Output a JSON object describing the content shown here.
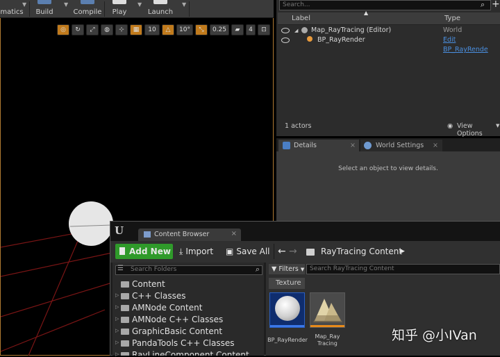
{
  "toolbar": {
    "items": [
      {
        "label": "matics"
      },
      {
        "label": "Build"
      },
      {
        "label": "Compile"
      },
      {
        "label": "Play"
      },
      {
        "label": "Launch"
      }
    ]
  },
  "viewport": {
    "tools": [
      "10",
      "10°",
      "0.25",
      "4"
    ]
  },
  "outliner": {
    "search_placeholder": "Search...",
    "columns": {
      "label": "Label",
      "type": "Type"
    },
    "rows": [
      {
        "label": "Map_RayTracing (Editor)",
        "type": "World"
      },
      {
        "label": "BP_RayRender",
        "type": "Edit BP_RayRende"
      }
    ],
    "actor_count": "1 actors",
    "view_options": "View Options"
  },
  "details": {
    "tabs": [
      "Details",
      "World Settings"
    ],
    "empty_message": "Select an object to view details."
  },
  "content_browser": {
    "tab": "Content Browser",
    "add_new": "Add New",
    "import": "Import",
    "save_all": "Save All",
    "path": "RayTracing Content",
    "search_folders": "Search Folders",
    "filters": "Filters",
    "search_assets": "Search RayTracing Content",
    "filter_chip": "Texture",
    "folders": [
      "Content",
      "C++ Classes",
      "AMNode Content",
      "AMNode C++ Classes",
      "GraphicBasic Content",
      "PandaTools C++ Classes",
      "RayLineComponent Content"
    ],
    "assets": [
      {
        "name": "BP_RayRender"
      },
      {
        "name": "Map_Ray Tracing"
      }
    ]
  },
  "watermark": "知乎 @小IVan"
}
